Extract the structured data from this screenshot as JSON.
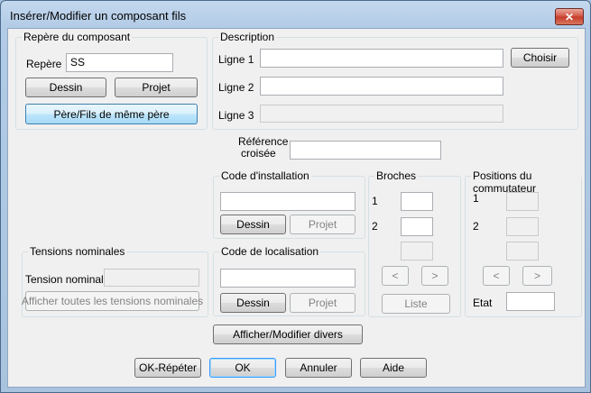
{
  "window": {
    "title": "Insérer/Modifier un composant fils",
    "close_glyph": "✕"
  },
  "repere": {
    "group_label": "Repère du composant",
    "label": "Repère",
    "value": "SS",
    "dessin_label": "Dessin",
    "projet_label": "Projet",
    "pere_fils_label": "Père/Fils de même père"
  },
  "description": {
    "group_label": "Description",
    "ligne1_label": "Ligne 1",
    "ligne1_value": "",
    "ligne2_label": "Ligne 2",
    "ligne2_value": "",
    "ligne3_label": "Ligne 3",
    "ligne3_value": "",
    "choisir_label": "Choisir"
  },
  "reference": {
    "label_line1": "Référence",
    "label_line2": "croisée",
    "value": ""
  },
  "installation": {
    "group_label": "Code d'installation",
    "value": "",
    "dessin_label": "Dessin",
    "projet_label": "Projet"
  },
  "localisation": {
    "group_label": "Code de localisation",
    "value": "",
    "dessin_label": "Dessin",
    "projet_label": "Projet"
  },
  "broches": {
    "group_label": "Broches",
    "row1_label": "1",
    "row2_label": "2",
    "prev_label": "<",
    "next_label": ">",
    "liste_label": "Liste"
  },
  "commutateur": {
    "group_label": "Positions du commutateur",
    "row1_label": "1",
    "row2_label": "2",
    "prev_label": "<",
    "next_label": ">",
    "etat_label": "Etat",
    "etat_value": ""
  },
  "tensions": {
    "group_label": "Tensions nominales",
    "tension_label": "Tension nominale",
    "tension_value": "",
    "afficher_label": "Afficher toutes les tensions nominales"
  },
  "divers_label": "Afficher/Modifier divers",
  "footer": {
    "ok_repeter": "OK-Répéter",
    "ok": "OK",
    "annuler": "Annuler",
    "aide": "Aide"
  },
  "colors": {
    "accent": "#3399ff",
    "window_frame": "#a9c3de",
    "close_red": "#c33b28"
  }
}
